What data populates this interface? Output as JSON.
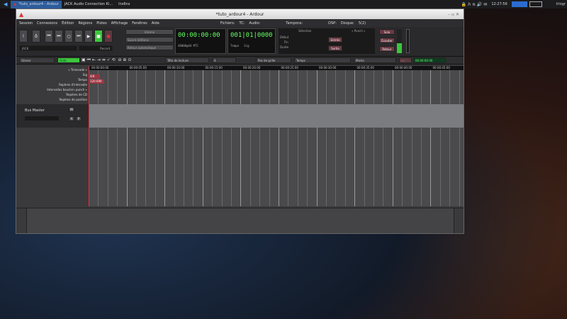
{
  "taskbar": {
    "tasks": [
      {
        "label": "*tuto_ardour4 - Ardour",
        "active": true
      },
      {
        "label": "JACK Audio Connection Ki...",
        "active": false
      },
      {
        "label": "Ins6ns",
        "active": false
      }
    ],
    "clock": "12:27:56",
    "user": "Iriogr"
  },
  "window": {
    "title": "*tuto_ardour4 - Ardour",
    "menu": [
      "Session",
      "Connexions",
      "Édition",
      "Régions",
      "Pistes",
      "Affichage",
      "Fenêtres",
      "Aide"
    ],
    "status": {
      "fichiers": "Fichiers:",
      "tc": "TC:",
      "audio": "Audio:",
      "tampons": "Tampons:",
      "dsp": "DSP:",
      "disque": "Disque:",
      "dsp_val": "5(2)"
    },
    "toolbar": {
      "mode": "Interne",
      "edit_mode": "Suivre éditions",
      "return": "Retour automatique",
      "jack_label": "JACK",
      "record": "Record",
      "clock_primary": "00:00:00:00",
      "clock_primary_sub": "48000@44 MTC",
      "clock_secondary": "001|01|0000",
      "tempo": "Tempo",
      "sig": "Sig",
      "selection": "Sélection",
      "punch": "« Punch »",
      "start": "Début",
      "end": "Fin",
      "length": "Durée",
      "in": "Entrée",
      "out": "Sortie",
      "solo": "Solo",
      "ecouter": "Écouter",
      "retour": "Retour"
    },
    "editor_bar": {
      "mode": "Glisser",
      "grab": "Grab",
      "zoom_focus": "Tête de lecture",
      "zoom_value": "4",
      "snap_mode": "Pas de grille",
      "grid": "Temps",
      "markers": "Marks",
      "nudge_clock": "00:00:00:00"
    },
    "rulers": [
      "« Timecode »",
      "Sig",
      "Tempo",
      "Repères d'intervalle",
      "Intervalles boucle/« punch »",
      "Repères de CD",
      "Repères de position"
    ],
    "ruler_values": {
      "sig": "4/4",
      "tempo": "120.000"
    },
    "timecodes": [
      "00:00:00:00",
      "00:00:05:00",
      "00:00:10:00",
      "00:00:15:00",
      "00:00:20:00",
      "00:00:25:00",
      "00:00:30:00",
      "00:00:35:00",
      "00:00:40:00",
      "00:00:45:00"
    ],
    "track": {
      "name": "Bus Master",
      "mute": "M",
      "a": "A",
      "p": "P"
    }
  },
  "colors": {
    "accent_green": "#3cc63c",
    "record_red": "#e03040",
    "clock_green": "#66ff66"
  }
}
